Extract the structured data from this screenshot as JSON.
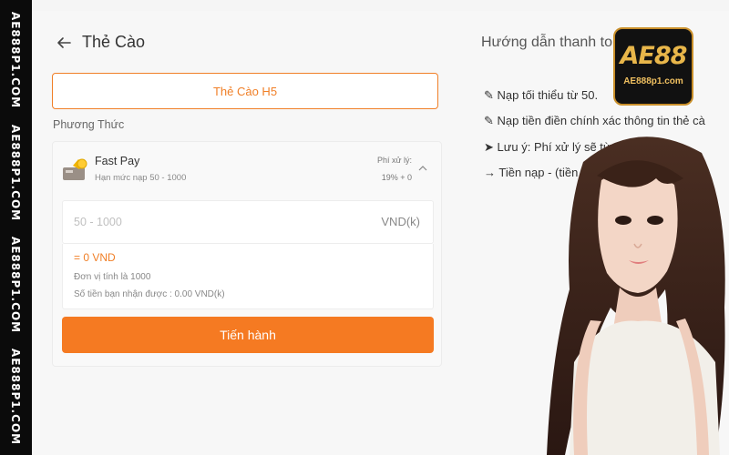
{
  "watermark": {
    "texts": [
      "AE888P1.COM",
      "AE888P1.COM",
      "AE888P1.COM",
      "AE888P1.COM"
    ]
  },
  "header": {
    "back_icon": "arrow-left-icon",
    "title": "Thẻ Cào"
  },
  "tab": {
    "label": "Thẻ Cào H5"
  },
  "method": {
    "section_label": "Phương Thức",
    "icon": "wallet-icon",
    "name": "Fast Pay",
    "limit": "Hạn mức nạp 50 - 1000",
    "fee_label": "Phí xử lý:",
    "fee_value": "19% + 0",
    "toggle_icon": "chevron-up-icon"
  },
  "form": {
    "amount_placeholder": "50 - 1000",
    "amount_value": "",
    "unit": "VND(k)",
    "result": "= 0 VND",
    "unit_note": "Đơn vị tính là 1000",
    "receive_note": "Số tiền bạn nhận được : 0.00 VND(k)",
    "submit_label": "Tiến hành"
  },
  "guide": {
    "title": "Hướng dẫn thanh to",
    "lines": [
      "✎ Nạp tối thiểu từ 50.",
      "✎ Nạp tiền điền chính xác thông tin thẻ cà",
      "➤ Lưu ý: Phí xử lý sẽ tùy",
      "→ Tiền nạp - (tiền nạp"
    ]
  },
  "logo": {
    "mark": "AE88",
    "sub": "AE888p1.com"
  },
  "colors": {
    "accent": "#f57a22",
    "accent_text": "#f07f27",
    "strip": "#0b0b0b",
    "logo_gold": "#e8b64a"
  }
}
